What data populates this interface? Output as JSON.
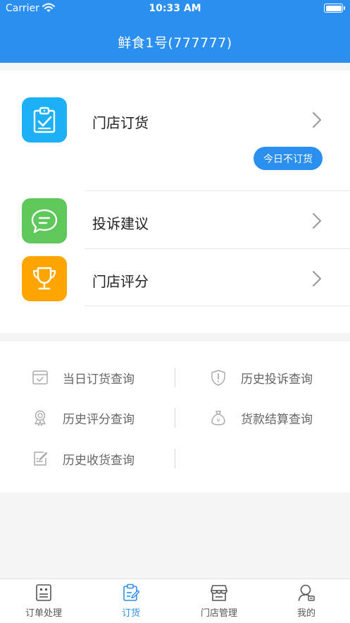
{
  "status_bar": {
    "carrier": "Carrier",
    "time": "10:33 AM"
  },
  "header": {
    "title": "鲜食1号(777777)"
  },
  "menu": {
    "items": [
      {
        "label": "门店订货",
        "icon": "clipboard-check-icon",
        "color": "#1cb0f6"
      },
      {
        "label": "投诉建议",
        "icon": "chat-bubble-icon",
        "color": "#5ec95a"
      },
      {
        "label": "门店评分",
        "icon": "trophy-icon",
        "color": "#ffa500"
      }
    ],
    "no_order_button": "今日不订货"
  },
  "queries": {
    "daily_order": "当日订货查询",
    "history_complaint": "历史投诉查询",
    "history_rating": "历史评分查询",
    "payment_settlement": "货款结算查询",
    "history_receipt": "历史收货查询"
  },
  "tabs": [
    {
      "label": "订单处理",
      "active": false
    },
    {
      "label": "订货",
      "active": true
    },
    {
      "label": "门店管理",
      "active": false
    },
    {
      "label": "我的",
      "active": false
    }
  ],
  "colors": {
    "primary": "#2b8ff0",
    "background": "#f5f5f5",
    "query_text": "#666666"
  }
}
